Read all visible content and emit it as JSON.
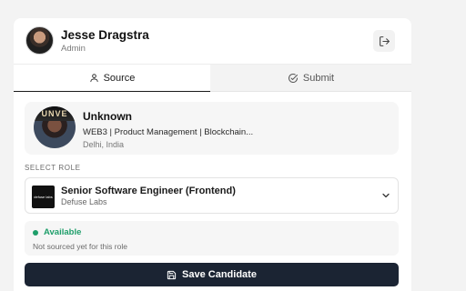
{
  "user": {
    "name": "Jesse Dragstra",
    "role": "Admin"
  },
  "icons": {
    "logout": "logout-icon",
    "source_tab": "user-icon",
    "submit_tab": "check-circle-icon",
    "dropdown": "chevron-down-icon",
    "save": "save-icon"
  },
  "tabs": [
    {
      "label": "Source",
      "active": true
    },
    {
      "label": "Submit",
      "active": false
    }
  ],
  "candidate": {
    "name": "Unknown",
    "headline": "WEB3 | Product Management | Blockchain...",
    "location": "Delhi, India",
    "photo_text": "UNVE"
  },
  "role_section": {
    "label": "SELECT ROLE",
    "selected_title": "Senior Software Engineer (Frontend)",
    "selected_company": "Defuse Labs",
    "company_logo_text": "defuse labs"
  },
  "status": {
    "title": "Available",
    "description": "Not sourced yet for this role",
    "color": "#1e9e6a"
  },
  "actions": {
    "save_label": "Save Candidate"
  },
  "colors": {
    "primary_button": "#1b2433",
    "background": "#f3f3f3"
  }
}
